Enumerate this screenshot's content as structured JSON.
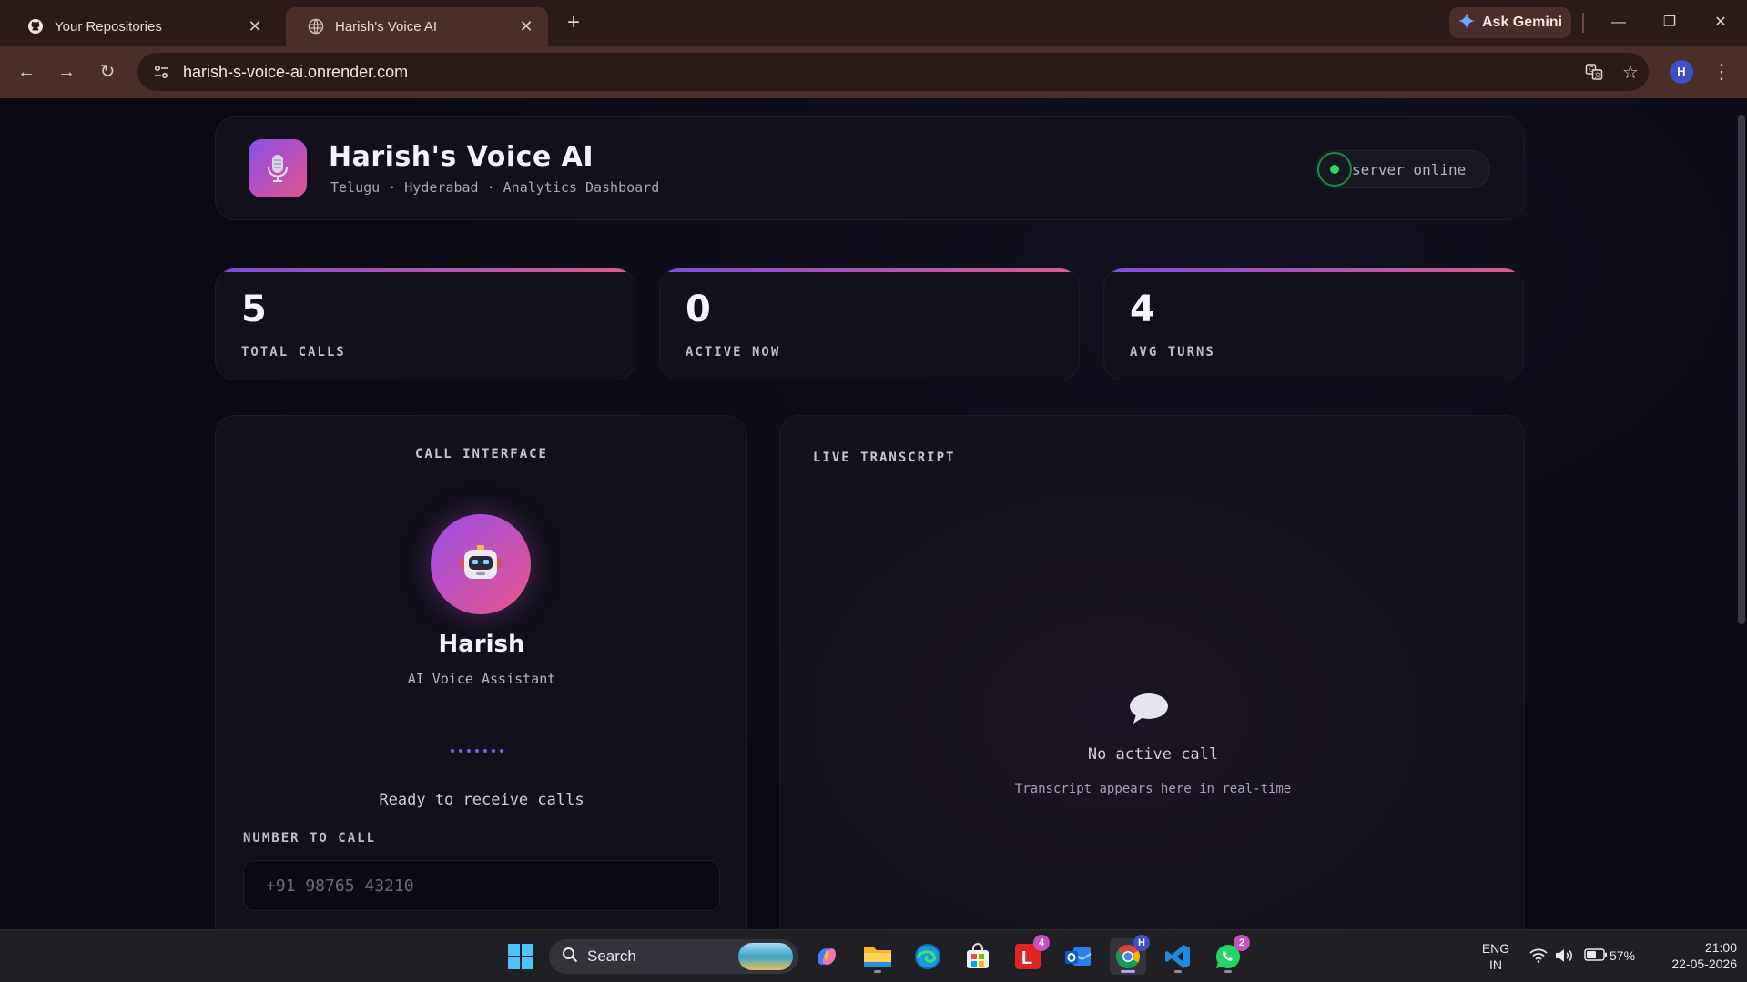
{
  "browser": {
    "tabs": [
      {
        "title": "Your Repositories",
        "icon": "github-icon",
        "active": false
      },
      {
        "title": "Harish's Voice AI",
        "icon": "globe-icon",
        "active": true
      }
    ],
    "gemini_label": "Ask Gemini",
    "url": "harish-s-voice-ai.onrender.com",
    "profile_initial": "H"
  },
  "header": {
    "title": "Harish's Voice AI",
    "subtitle": "Telugu · Hyderabad · Analytics Dashboard",
    "status": "server online"
  },
  "stats": [
    {
      "value": "5",
      "label": "TOTAL CALLS"
    },
    {
      "value": "0",
      "label": "ACTIVE NOW"
    },
    {
      "value": "4",
      "label": "AVG TURNS"
    }
  ],
  "call_interface": {
    "title": "CALL INTERFACE",
    "agent_name": "Harish",
    "agent_role": "AI Voice Assistant",
    "status_text": "Ready to receive calls",
    "number_label": "NUMBER TO CALL",
    "number_placeholder": "+91 98765 43210"
  },
  "transcript": {
    "title": "LIVE TRANSCRIPT",
    "empty_title": "No active call",
    "empty_hint": "Transcript appears here in real-time"
  },
  "taskbar": {
    "search_label": "Search",
    "apps": [
      {
        "name": "copilot-icon"
      },
      {
        "name": "file-explorer-icon"
      },
      {
        "name": "edge-icon"
      },
      {
        "name": "microsoft-store-icon"
      },
      {
        "name": "l-app-icon",
        "badge": "4"
      },
      {
        "name": "outlook-icon"
      },
      {
        "name": "chrome-icon",
        "badge": "H"
      },
      {
        "name": "vscode-icon"
      },
      {
        "name": "whatsapp-icon",
        "badge": "2"
      }
    ],
    "language": "ENG",
    "region": "IN",
    "battery": "57%",
    "time": "21:00",
    "date": "22-05-2026"
  },
  "colors": {
    "accent_purple": "#7b4fe0",
    "accent_pink": "#e05a8a",
    "status_green": "#34d36a",
    "page_bg": "#0b0a13"
  }
}
